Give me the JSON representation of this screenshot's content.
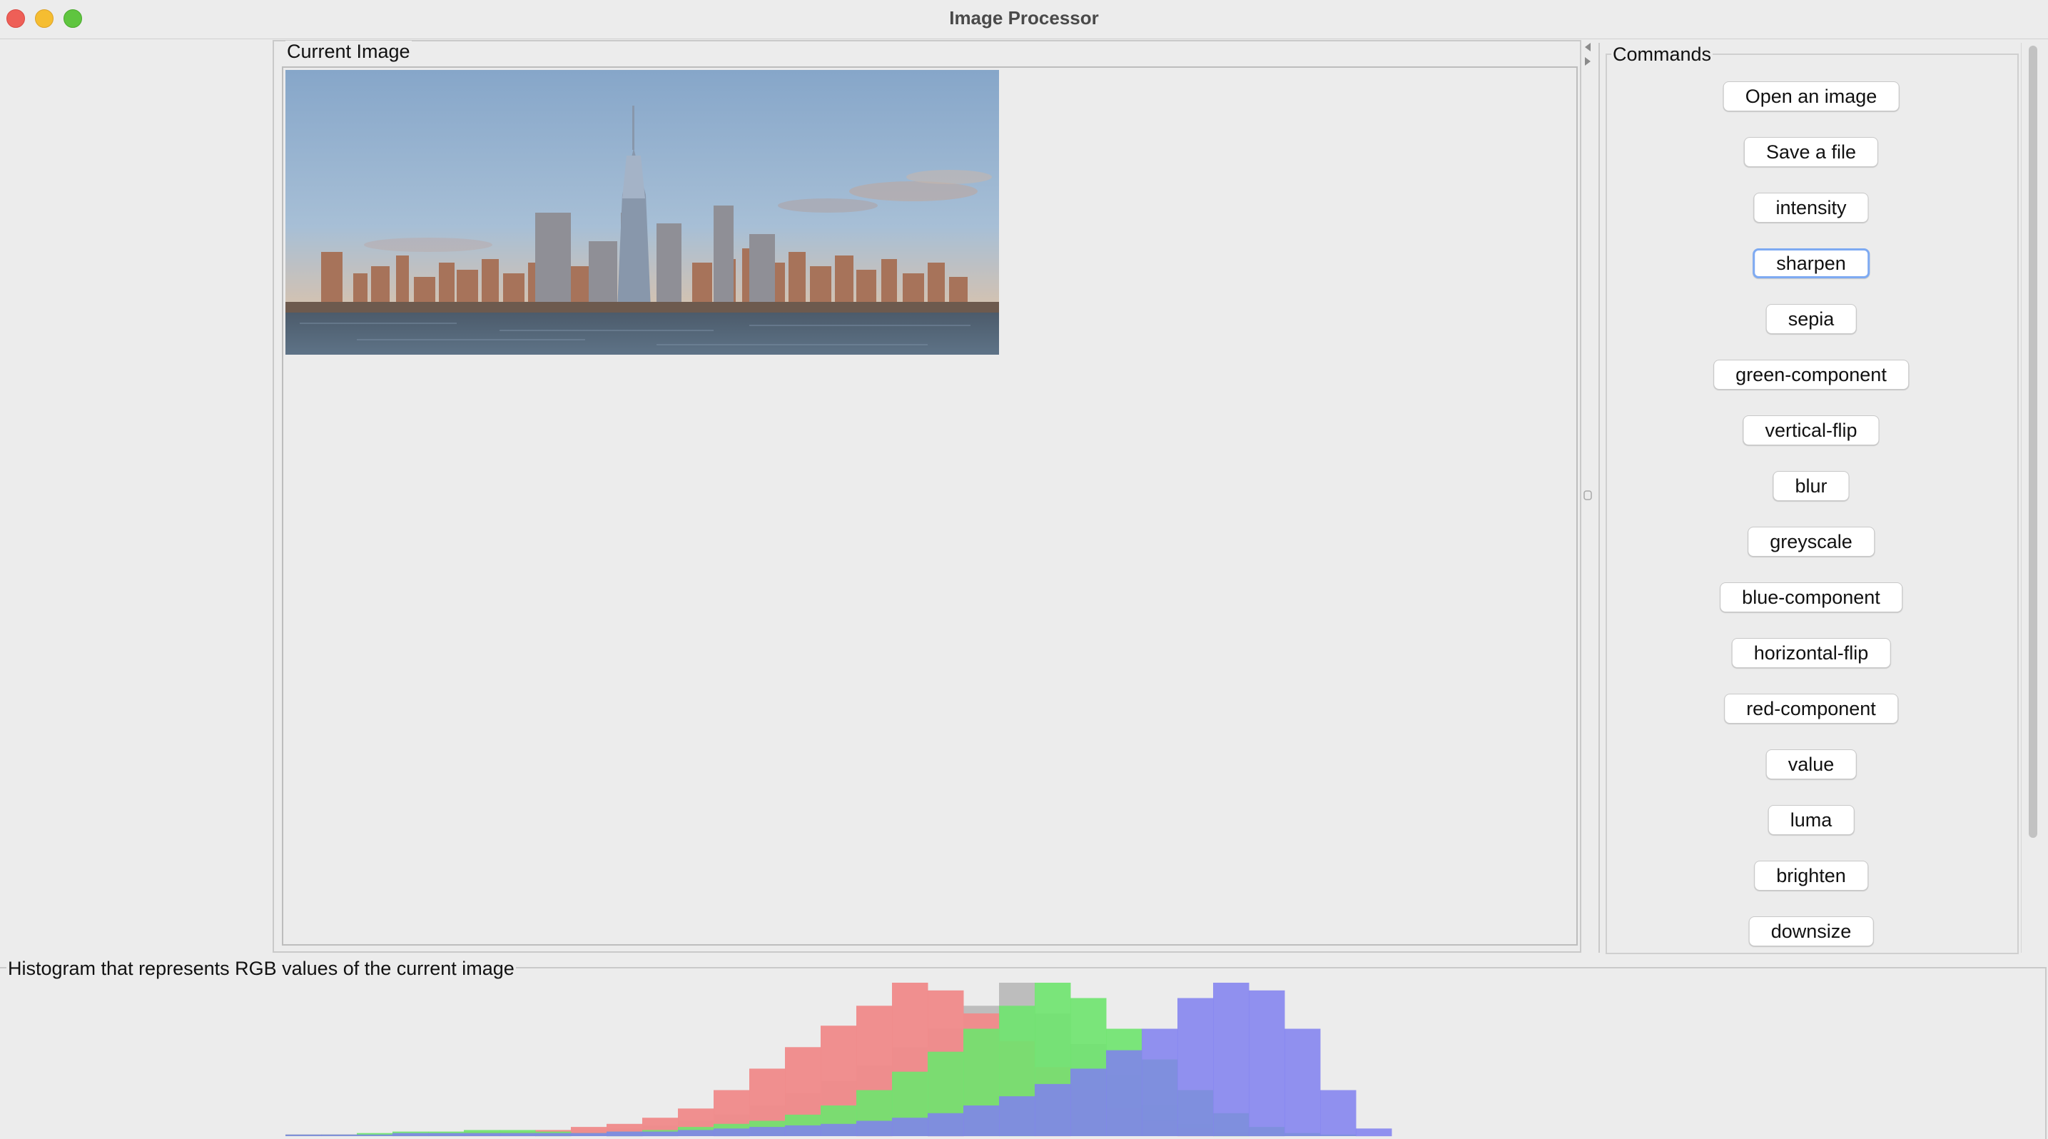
{
  "window": {
    "title": "Image Processor"
  },
  "image_panel": {
    "label": "Current Image",
    "image_alt": "City skyline over water at sunset"
  },
  "commands_panel": {
    "label": "Commands",
    "buttons": [
      {
        "label": "Open an image"
      },
      {
        "label": "Save a file"
      },
      {
        "label": "intensity"
      },
      {
        "label": "sharpen",
        "focused": true
      },
      {
        "label": "sepia"
      },
      {
        "label": "green-component"
      },
      {
        "label": "vertical-flip"
      },
      {
        "label": "blur"
      },
      {
        "label": "greyscale"
      },
      {
        "label": "blue-component"
      },
      {
        "label": "horizontal-flip"
      },
      {
        "label": "red-component"
      },
      {
        "label": "value"
      },
      {
        "label": "luma"
      },
      {
        "label": "brighten"
      },
      {
        "label": "downsize"
      }
    ]
  },
  "histogram": {
    "label": "Histogram that represents RGB values of the current image",
    "colors": {
      "red": "#f08a8a",
      "green": "#6ee46e",
      "blue": "#8080f0",
      "intensity": "#b8b8b8"
    }
  },
  "chart_data": {
    "type": "area",
    "series": [
      {
        "name": "",
        "color": "red",
        "values": [
          0,
          0,
          0,
          0,
          1,
          1,
          1,
          2,
          2,
          3,
          3,
          4,
          6,
          8,
          12,
          18,
          30,
          44,
          58,
          72,
          85,
          100,
          95,
          80,
          62,
          45,
          30,
          18,
          10,
          5,
          2,
          1,
          0,
          0,
          0,
          0,
          0,
          0,
          0,
          0
        ]
      },
      {
        "name": "",
        "color": "green",
        "values": [
          0,
          0,
          0,
          0,
          1,
          1,
          2,
          3,
          3,
          4,
          4,
          3,
          2,
          3,
          4,
          6,
          8,
          10,
          14,
          20,
          30,
          42,
          55,
          70,
          85,
          100,
          90,
          70,
          50,
          30,
          15,
          6,
          2,
          1,
          0,
          0,
          0,
          0,
          0,
          0
        ]
      },
      {
        "name": "",
        "color": "blue",
        "values": [
          0,
          0,
          0,
          0,
          1,
          1,
          1,
          2,
          2,
          2,
          2,
          2,
          2,
          3,
          3,
          4,
          5,
          6,
          7,
          8,
          10,
          12,
          15,
          20,
          26,
          34,
          44,
          56,
          70,
          90,
          100,
          95,
          70,
          30,
          5,
          0,
          0,
          0,
          0,
          0
        ]
      },
      {
        "name": "",
        "color": "intensity",
        "values": [
          0,
          0,
          0,
          0,
          0,
          1,
          1,
          1,
          2,
          2,
          2,
          3,
          4,
          5,
          7,
          10,
          14,
          20,
          28,
          36,
          46,
          58,
          70,
          85,
          100,
          80,
          60,
          40,
          20,
          8,
          3,
          1,
          0,
          0,
          0,
          0,
          0,
          0,
          0,
          0
        ]
      }
    ]
  }
}
